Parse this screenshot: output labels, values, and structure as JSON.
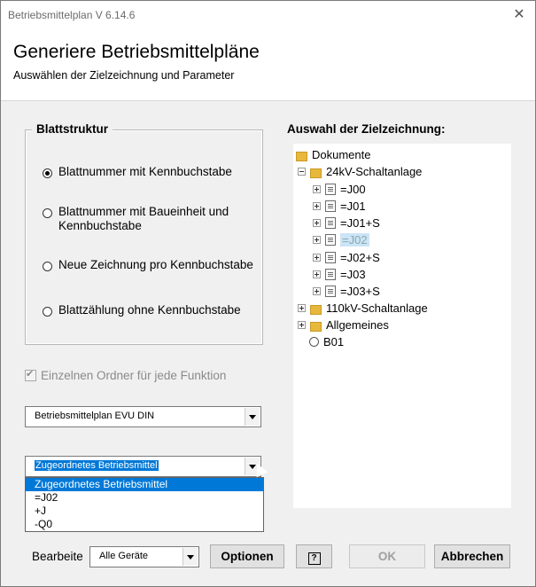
{
  "window": {
    "title": "Betriebsmittelplan  V 6.14.6",
    "close_glyph": "✕"
  },
  "header": {
    "title": "Generiere Betriebsmittelpläne",
    "subtitle": "Auswählen der Zielzeichnung und Parameter"
  },
  "blattstruktur": {
    "title": "Blattstruktur",
    "options": [
      {
        "label": "Blattnummer mit Kennbuchstabe",
        "selected": true
      },
      {
        "label": "Blattnummer mit Baueinheit und Kennbuchstabe",
        "selected": false
      },
      {
        "label": "Neue Zeichnung pro Kennbuchstabe",
        "selected": false
      },
      {
        "label": "Blattzählung ohne Kennbuchstabe",
        "selected": false
      }
    ]
  },
  "checkbox": {
    "label": "Einzelnen Ordner für jede Funktion",
    "checked": true,
    "disabled": true
  },
  "combo1": {
    "value": "Betriebsmittelplan EVU DIN"
  },
  "combo2": {
    "value": "Zugeordnetes Betriebsmittel",
    "options": [
      "Zugeordnetes Betriebsmittel",
      "=J02",
      "+J",
      "-Q0"
    ],
    "highlighted_index": 0
  },
  "tree": {
    "title": "Auswahl der Zielzeichnung:",
    "nodes": [
      {
        "label": "Dokumente",
        "type": "root"
      },
      {
        "label": "24kV-Schaltanlage",
        "type": "folder",
        "expanded": true
      },
      {
        "label": "=J00",
        "type": "doc"
      },
      {
        "label": "=J01",
        "type": "doc"
      },
      {
        "label": "=J01+S",
        "type": "doc"
      },
      {
        "label": "=J02",
        "type": "doc",
        "highlighted": true
      },
      {
        "label": "=J02+S",
        "type": "doc"
      },
      {
        "label": "=J03",
        "type": "doc"
      },
      {
        "label": "=J03+S",
        "type": "doc"
      },
      {
        "label": "110kV-Schaltanlage",
        "type": "folder",
        "expanded": false
      },
      {
        "label": "Allgemeines",
        "type": "folder",
        "expanded": false
      },
      {
        "label": "B01",
        "type": "special"
      }
    ]
  },
  "footer": {
    "bearbeite_label": "Bearbeite",
    "bearbeite_value": "Alle Geräte",
    "optionen": "Optionen",
    "help": "?",
    "ok": "OK",
    "abbrechen": "Abbrechen"
  }
}
